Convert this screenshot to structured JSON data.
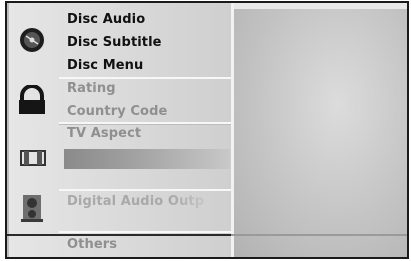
{
  "menu": {
    "items": [
      {
        "label": "Disc Audio"
      },
      {
        "label": "Disc Subtitle"
      },
      {
        "label": "Disc Menu"
      },
      {
        "label": "Rating"
      },
      {
        "label": "Country Code"
      },
      {
        "label": "TV Aspect"
      },
      {
        "label": "Digital Audio Outp"
      },
      {
        "label": "Others"
      }
    ]
  },
  "icons": {
    "disc": "disc-icon",
    "lock": "lock-icon",
    "tv_aspect": "tv-aspect-icon",
    "speaker": "speaker-icon"
  },
  "colors": {
    "menu_bg": "#d8d8d8",
    "panel_bg": "#c4c4c4",
    "highlight": "#999999",
    "text": "#111111"
  }
}
